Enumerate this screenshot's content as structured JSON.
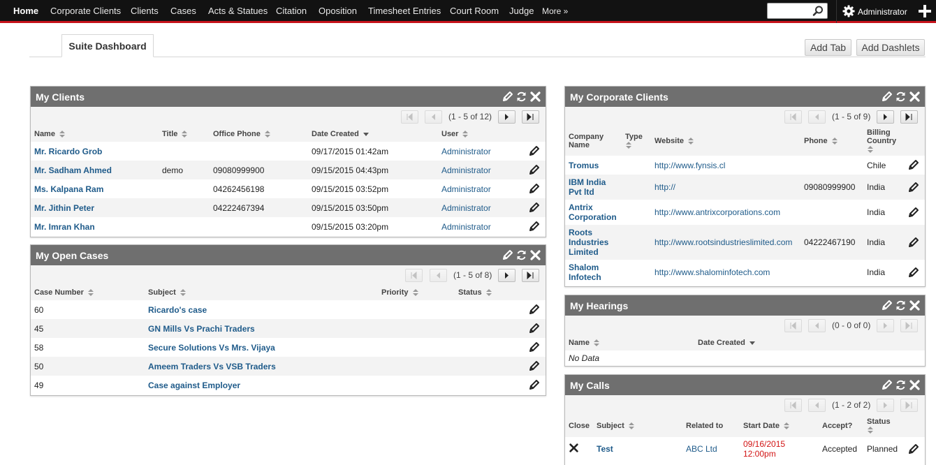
{
  "nav": {
    "items": [
      "Home",
      "Corporate Clients",
      "Clients",
      "Cases",
      "Acts & Statues",
      "Citation",
      "Oposition",
      "Timesheet Entries",
      "Court Room",
      "Judge",
      "More »"
    ],
    "admin": "Administrator",
    "icons": [
      "search-icon",
      "gear-icon",
      "plus-icon"
    ]
  },
  "tabs": {
    "active": "Suite Dashboard",
    "add_tab": "Add Tab",
    "add_dashlets": "Add Dashlets"
  },
  "colors": {
    "nav_bg": "#121212",
    "nav_accent": "#c6121b",
    "header_bg": "#6f6f6f",
    "link": "#1f5b8a",
    "date_red": "#d21414"
  },
  "clients": {
    "title": "My Clients",
    "pager": "(1 - 5 of 12)",
    "columns": [
      "Name",
      "Title",
      "Office Phone",
      "Date Created",
      "User"
    ],
    "rows": [
      [
        "Mr. Ricardo Grob",
        "",
        "",
        "09/17/2015 01:42am",
        "Administrator"
      ],
      [
        "Mr. Sadham Ahmed",
        "demo",
        "09080999900",
        "09/15/2015 04:43pm",
        "Administrator"
      ],
      [
        "Ms. Kalpana Ram",
        "",
        "04262456198",
        "09/15/2015 03:52pm",
        "Administrator"
      ],
      [
        "Mr. Jithin Peter",
        "",
        "04222467394",
        "09/15/2015 03:50pm",
        "Administrator"
      ],
      [
        "Mr. Imran Khan",
        "",
        "",
        "09/15/2015 03:20pm",
        "Administrator"
      ]
    ]
  },
  "cases": {
    "title": "My Open Cases",
    "pager": "(1 - 5 of 8)",
    "columns": [
      "Case Number",
      "Subject",
      "Priority",
      "Status"
    ],
    "rows": [
      [
        "60",
        "Ricardo's case",
        "",
        ""
      ],
      [
        "45",
        "GN Mills Vs Prachi Traders",
        "",
        ""
      ],
      [
        "58",
        "Secure Solutions Vs Mrs. Vijaya",
        "",
        ""
      ],
      [
        "50",
        "Ameem Traders Vs VSB Traders",
        "",
        ""
      ],
      [
        "49",
        "Case against Employer",
        "",
        ""
      ]
    ]
  },
  "corporate": {
    "title": "My Corporate Clients",
    "pager": "(1 - 5 of 9)",
    "columns": [
      "Company Name",
      "Type",
      "Website",
      "Phone",
      "Billing Country"
    ],
    "rows": [
      [
        "Tromus",
        "",
        "http://www.fynsis.cl",
        "",
        "Chile"
      ],
      [
        "IBM India Pvt ltd",
        "",
        "http://",
        "09080999900",
        "India"
      ],
      [
        "Antrix Corporation",
        "",
        "http://www.antrixcorporations.com",
        "",
        "India"
      ],
      [
        "Roots Industries Limited",
        "",
        "http://www.rootsindustrieslimited.com",
        "04222467190",
        "India"
      ],
      [
        "Shalom Infotech",
        "",
        "http://www.shalominfotech.com",
        "",
        "India"
      ]
    ]
  },
  "hearings": {
    "title": "My Hearings",
    "pager": "(0 - 0 of 0)",
    "columns": [
      "Name",
      "Date Created"
    ],
    "nodata": "No Data"
  },
  "calls": {
    "title": "My Calls",
    "pager": "(1 - 2 of 2)",
    "columns": [
      "Close",
      "Subject",
      "Related to",
      "Start Date",
      "Accept?",
      "Status"
    ],
    "rows": [
      [
        "",
        "Test",
        "ABC Ltd",
        "09/16/2015 12:00pm",
        "Accepted",
        "Planned"
      ]
    ]
  }
}
